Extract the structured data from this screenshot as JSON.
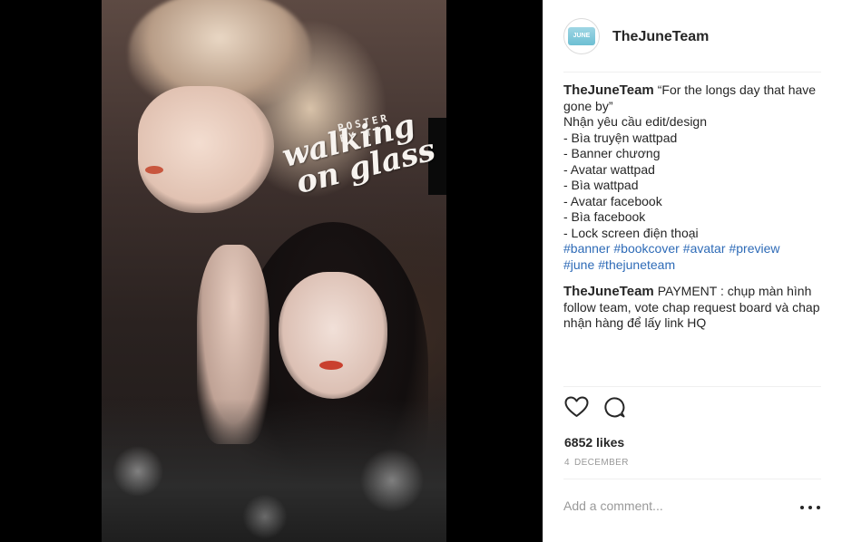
{
  "post_image": {
    "poster_byline": "POSTER BY TJT",
    "poster_title_line1": "walking",
    "poster_title_line2": "on glass"
  },
  "header": {
    "username": "TheJuneTeam",
    "avatar_text": "JUNE"
  },
  "caption": {
    "username": "TheJuneTeam",
    "lines": [
      "“For the longs day that have gone by”",
      "Nhận yêu cầu edit/design",
      "- Bìa truyện wattpad",
      "- Banner chương",
      "- Avatar wattpad",
      "- Bìa wattpad",
      "- Avatar facebook",
      "- Bìa facebook",
      "- Lock screen điện thoại"
    ],
    "hashtags": [
      "#banner",
      "#bookcover",
      "#avatar",
      "#preview",
      "#june",
      "#thejuneteam"
    ]
  },
  "comment": {
    "username": "TheJuneTeam",
    "text": "PAYMENT : chụp màn hình follow team, vote chap request board và chap nhận hàng để lấy link HQ"
  },
  "actions": {
    "like_icon": "heart-icon",
    "comment_icon": "comment-bubble-icon"
  },
  "stats": {
    "likes": "6852 likes",
    "date_day": "4",
    "date_month": "DECEMBER"
  },
  "add_comment": {
    "placeholder": "Add a comment...",
    "more_icon": "more-options-icon"
  }
}
